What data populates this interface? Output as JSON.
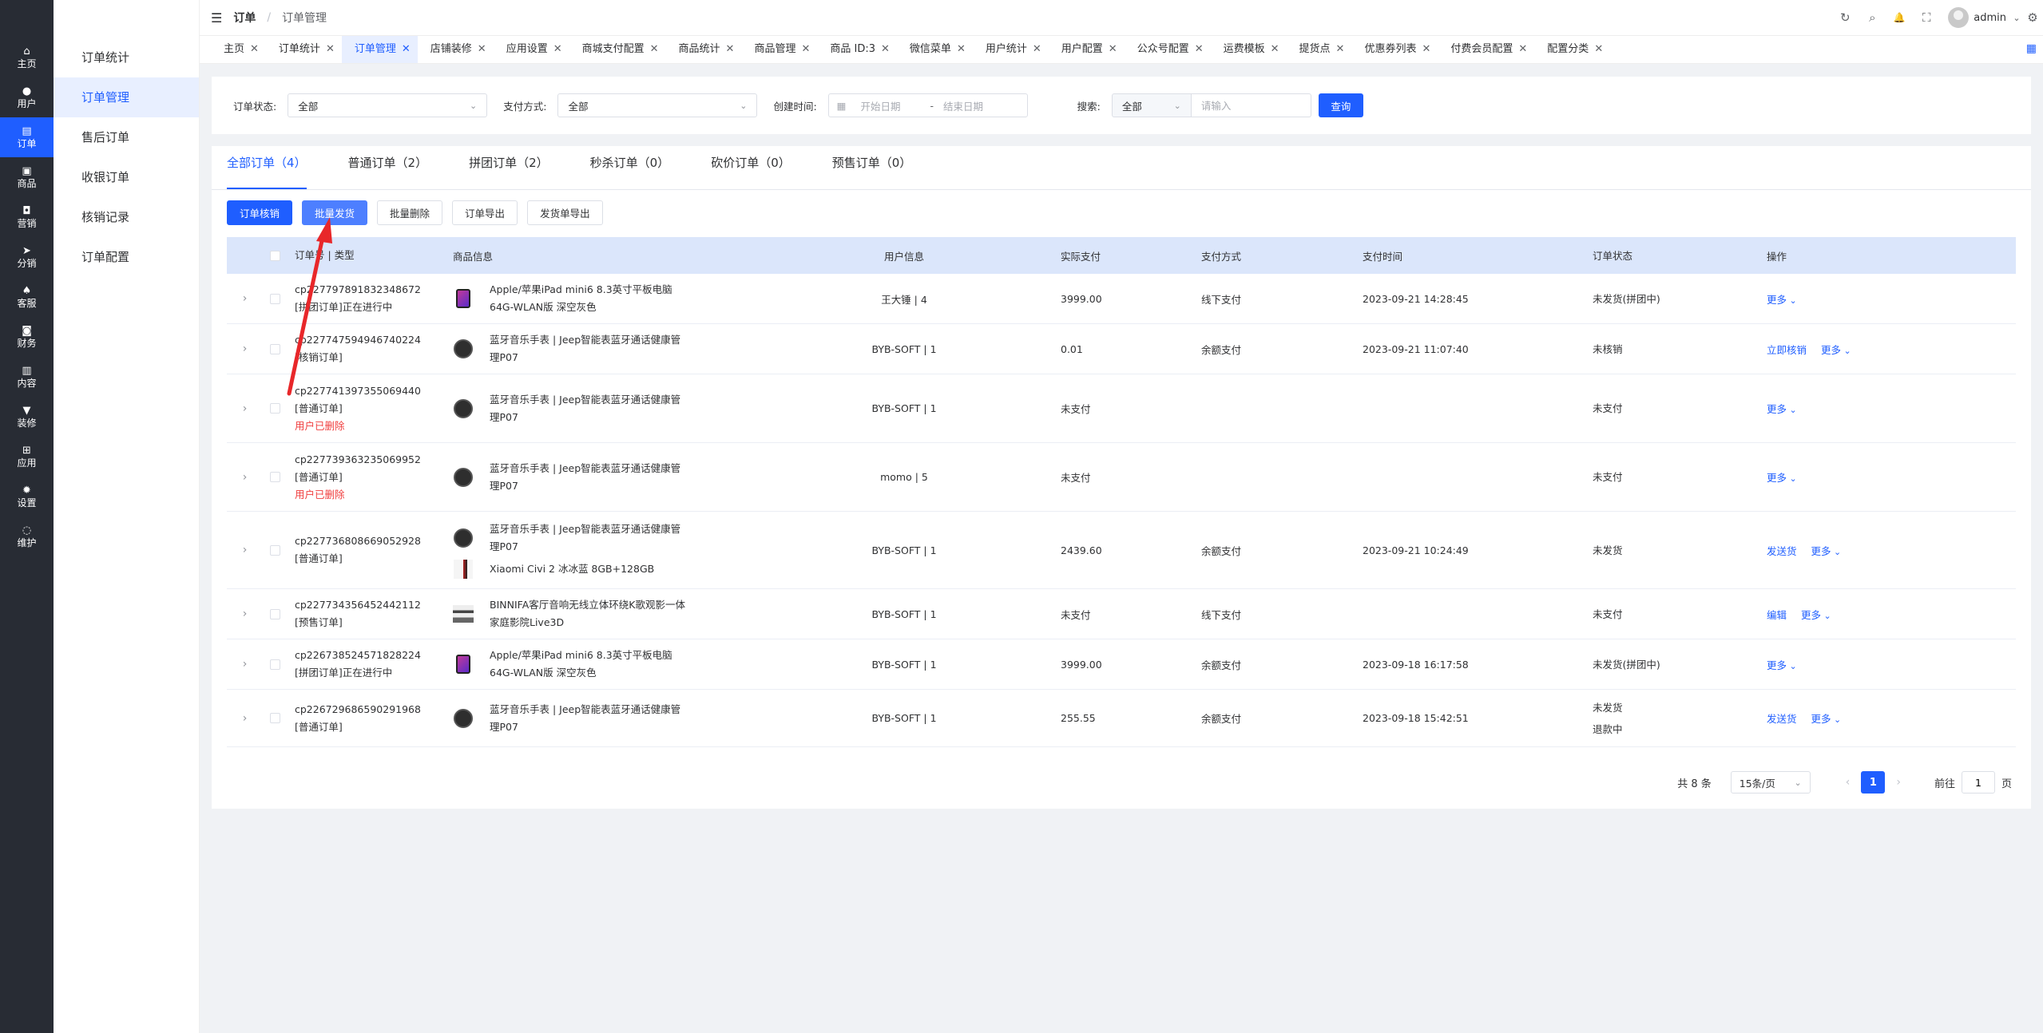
{
  "sidebar": {
    "items": [
      {
        "icon": "home-icon",
        "glyph": "⌂",
        "label": "主页",
        "active": false
      },
      {
        "icon": "user-icon",
        "glyph": "●",
        "label": "用户",
        "active": false
      },
      {
        "icon": "order-icon",
        "glyph": "▤",
        "label": "订单",
        "active": true
      },
      {
        "icon": "goods-icon",
        "glyph": "▣",
        "label": "商品",
        "active": false
      },
      {
        "icon": "marketing-icon",
        "glyph": "◘",
        "label": "营销",
        "active": false
      },
      {
        "icon": "share-icon",
        "glyph": "➤",
        "label": "分销",
        "active": false
      },
      {
        "icon": "service-icon",
        "glyph": "♠",
        "label": "客服",
        "active": false
      },
      {
        "icon": "finance-icon",
        "glyph": "◙",
        "label": "财务",
        "active": false
      },
      {
        "icon": "content-icon",
        "glyph": "▥",
        "label": "内容",
        "active": false
      },
      {
        "icon": "decorate-icon",
        "glyph": "▼",
        "label": "装修",
        "active": false
      },
      {
        "icon": "apps-icon",
        "glyph": "⊞",
        "label": "应用",
        "active": false
      },
      {
        "icon": "settings-icon",
        "glyph": "✹",
        "label": "设置",
        "active": false
      },
      {
        "icon": "maintain-icon",
        "glyph": "◌",
        "label": "维护",
        "active": false
      }
    ]
  },
  "submenu": {
    "items": [
      {
        "label": "订单统计",
        "active": false
      },
      {
        "label": "订单管理",
        "active": true
      },
      {
        "label": "售后订单",
        "active": false
      },
      {
        "label": "收银订单",
        "active": false
      },
      {
        "label": "核销记录",
        "active": false
      },
      {
        "label": "订单配置",
        "active": false
      }
    ]
  },
  "header": {
    "menu_glyph": "☰",
    "breadcrumb_root": "订单",
    "breadcrumb_sep": "/",
    "breadcrumb_current": "订单管理",
    "username": "admin",
    "icons": {
      "refresh": "↻",
      "search": "⌕",
      "bell": "🔔",
      "fullscreen": "⛶",
      "gear": "⚙",
      "caret": "⌄"
    }
  },
  "tabs": [
    {
      "label": "主页",
      "active": false
    },
    {
      "label": "订单统计",
      "active": false
    },
    {
      "label": "订单管理",
      "active": true
    },
    {
      "label": "店铺装修",
      "active": false
    },
    {
      "label": "应用设置",
      "active": false
    },
    {
      "label": "商城支付配置",
      "active": false
    },
    {
      "label": "商品统计",
      "active": false
    },
    {
      "label": "商品管理",
      "active": false
    },
    {
      "label": "商品 ID:3",
      "active": false
    },
    {
      "label": "微信菜单",
      "active": false
    },
    {
      "label": "用户统计",
      "active": false
    },
    {
      "label": "用户配置",
      "active": false
    },
    {
      "label": "公众号配置",
      "active": false
    },
    {
      "label": "运费模板",
      "active": false
    },
    {
      "label": "提货点",
      "active": false
    },
    {
      "label": "优惠券列表",
      "active": false
    },
    {
      "label": "付费会员配置",
      "active": false
    },
    {
      "label": "配置分类",
      "active": false
    }
  ],
  "filter": {
    "status_label": "订单状态:",
    "status_value": "全部",
    "pay_label": "支付方式:",
    "pay_value": "全部",
    "created_label": "创建时间:",
    "start_placeholder": "开始日期",
    "range_sep": "-",
    "end_placeholder": "结束日期",
    "search_label": "搜索:",
    "search_type": "全部",
    "search_placeholder": "请输入",
    "query_button": "查询"
  },
  "order_tabs": [
    {
      "label": "全部订单（4）",
      "active": true
    },
    {
      "label": "普通订单（2）",
      "active": false
    },
    {
      "label": "拼团订单（2）",
      "active": false
    },
    {
      "label": "秒杀订单（0）",
      "active": false
    },
    {
      "label": "砍价订单（0）",
      "active": false
    },
    {
      "label": "预售订单（0）",
      "active": false
    }
  ],
  "actions": {
    "verify": "订单核销",
    "batch_ship": "批量发货",
    "batch_delete": "批量删除",
    "export_orders": "订单导出",
    "export_shipping": "发货单导出"
  },
  "table": {
    "headers": {
      "order_no": "订单号 | 类型",
      "goods": "商品信息",
      "user": "用户信息",
      "paid": "实际支付",
      "method": "支付方式",
      "time": "支付时间",
      "status": "订单状态",
      "op": "操作"
    },
    "rows": [
      {
        "order_no": "cp227797891832348672",
        "type": "[拼团订单]正在进行中",
        "note": "",
        "goods": [
          {
            "thumb": "ipad",
            "name": "Apple/苹果iPad mini6 8.3英寸平板电脑 64G-WLAN版 深空灰色"
          }
        ],
        "user": "王大锤 | 4",
        "paid": "3999.00",
        "method": "线下支付",
        "time": "2023-09-21 14:28:45",
        "status": [
          "未发货(拼团中)"
        ],
        "ops": [
          "更多"
        ]
      },
      {
        "order_no": "cp227747594946740224",
        "type": "[核销订单]",
        "note": "",
        "goods": [
          {
            "thumb": "watch",
            "name": "蓝牙音乐手表 | Jeep智能表蓝牙通话健康管理P07"
          }
        ],
        "user": "BYB-SOFT | 1",
        "paid": "0.01",
        "method": "余额支付",
        "time": "2023-09-21 11:07:40",
        "status": [
          "未核销"
        ],
        "ops": [
          "立即核销",
          "更多"
        ]
      },
      {
        "order_no": "cp227741397355069440",
        "type": "[普通订单]",
        "note": "用户已删除",
        "goods": [
          {
            "thumb": "watch",
            "name": "蓝牙音乐手表 | Jeep智能表蓝牙通话健康管理P07"
          }
        ],
        "user": "BYB-SOFT | 1",
        "paid": "未支付",
        "method": "",
        "time": "",
        "status": [
          "未支付"
        ],
        "ops": [
          "更多"
        ]
      },
      {
        "order_no": "cp227739363235069952",
        "type": "[普通订单]",
        "note": "用户已删除",
        "goods": [
          {
            "thumb": "watch",
            "name": "蓝牙音乐手表 | Jeep智能表蓝牙通话健康管理P07"
          }
        ],
        "user": "momo | 5",
        "paid": "未支付",
        "method": "",
        "time": "",
        "status": [
          "未支付"
        ],
        "ops": [
          "更多"
        ]
      },
      {
        "order_no": "cp227736808669052928",
        "type": "[普通订单]",
        "note": "",
        "goods": [
          {
            "thumb": "watch",
            "name": "蓝牙音乐手表 | Jeep智能表蓝牙通话健康管理P07"
          },
          {
            "thumb": "phone",
            "name": "Xiaomi Civi 2 冰冰蓝 8GB+128GB"
          }
        ],
        "user": "BYB-SOFT | 1",
        "paid": "2439.60",
        "method": "余额支付",
        "time": "2023-09-21 10:24:49",
        "status": [
          "未发货"
        ],
        "ops": [
          "发送货",
          "更多"
        ]
      },
      {
        "order_no": "cp227734356452442112",
        "type": "[预售订单]",
        "note": "",
        "goods": [
          {
            "thumb": "sound",
            "name": "BINNIFA客厅音响无线立体环绕K歌观影一体家庭影院Live3D"
          }
        ],
        "user": "BYB-SOFT | 1",
        "paid": "未支付",
        "method": "线下支付",
        "time": "",
        "status": [
          "未支付"
        ],
        "ops": [
          "编辑",
          "更多"
        ]
      },
      {
        "order_no": "cp226738524571828224",
        "type": "[拼团订单]正在进行中",
        "note": "",
        "goods": [
          {
            "thumb": "ipad",
            "name": "Apple/苹果iPad mini6 8.3英寸平板电脑 64G-WLAN版 深空灰色"
          }
        ],
        "user": "BYB-SOFT | 1",
        "paid": "3999.00",
        "method": "余额支付",
        "time": "2023-09-18 16:17:58",
        "status": [
          "未发货(拼团中)"
        ],
        "ops": [
          "更多"
        ]
      },
      {
        "order_no": "cp226729686590291968",
        "type": "[普通订单]",
        "note": "",
        "goods": [
          {
            "thumb": "watch",
            "name": "蓝牙音乐手表 | Jeep智能表蓝牙通话健康管理P07"
          }
        ],
        "user": "BYB-SOFT | 1",
        "paid": "255.55",
        "method": "余额支付",
        "time": "2023-09-18 15:42:51",
        "status": [
          "未发货",
          "退款中"
        ],
        "ops": [
          "发送货",
          "更多"
        ]
      }
    ]
  },
  "pagination": {
    "total": "共 8 条",
    "page_size": "15条/页",
    "prev": "‹",
    "current": "1",
    "next": "›",
    "goto_label": "前往",
    "goto_value": "1",
    "page_unit": "页"
  },
  "colors": {
    "accent": "#1f5eff",
    "sidebar": "#282c34",
    "danger": "#f03e3e",
    "annotation_arrow": "#e8272a"
  }
}
